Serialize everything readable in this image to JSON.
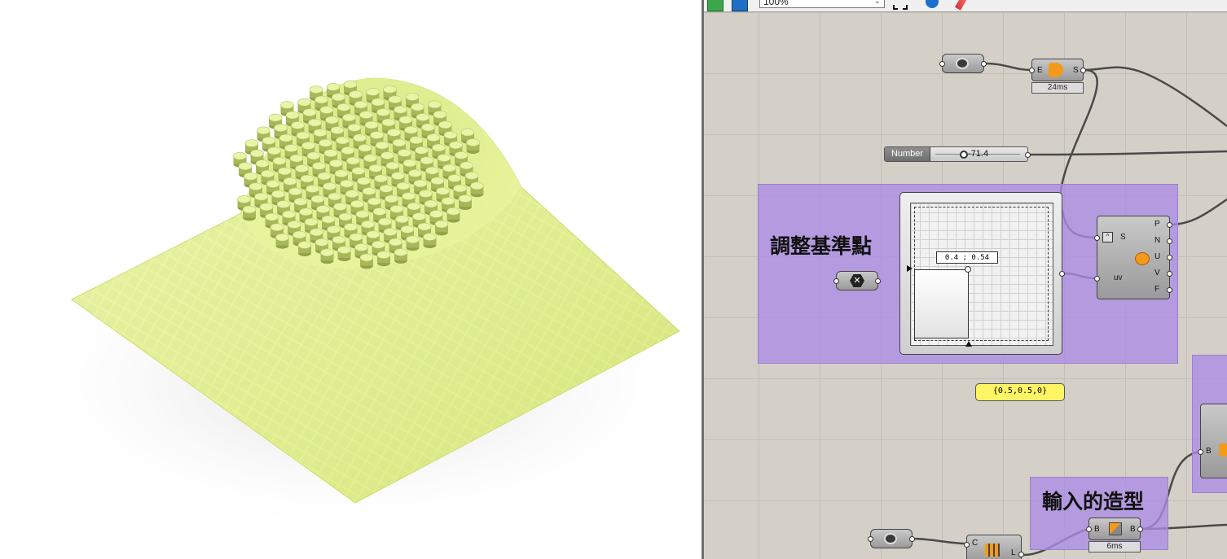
{
  "toolbar": {
    "zoom_value": "100%",
    "icons": [
      "new-file-icon",
      "save-icon",
      "zoom-extents-icon",
      "preview-eye-icon",
      "sketch-pen-icon"
    ]
  },
  "groups": {
    "adjust_point": {
      "title": "調整基準點"
    },
    "input_shape": {
      "title": "輸入的造型"
    }
  },
  "components": {
    "number_slider": {
      "label": "Number",
      "value": "-71.4"
    },
    "graph_mapper_readout": "0.4 ; 0.54",
    "point_panel": "{0.5,0.5,0}",
    "evaluate_surface": {
      "in_s": "S",
      "in_uv": "uv",
      "out": [
        "P",
        "N",
        "U",
        "V",
        "F"
      ]
    },
    "edge_comp": {
      "in": "E",
      "out": "S",
      "timer": "24ms"
    },
    "brep_comp": {
      "in": "B",
      "out": "B",
      "timer": "6ms"
    },
    "bottom_comp": {
      "in_c": "C",
      "out": "L"
    },
    "right_comp": {
      "in": "B"
    }
  },
  "colors": {
    "canvas": "#d4d0c8",
    "group": "#aa8ce6",
    "panel": "#fff564",
    "surface": "#e8f59a"
  }
}
